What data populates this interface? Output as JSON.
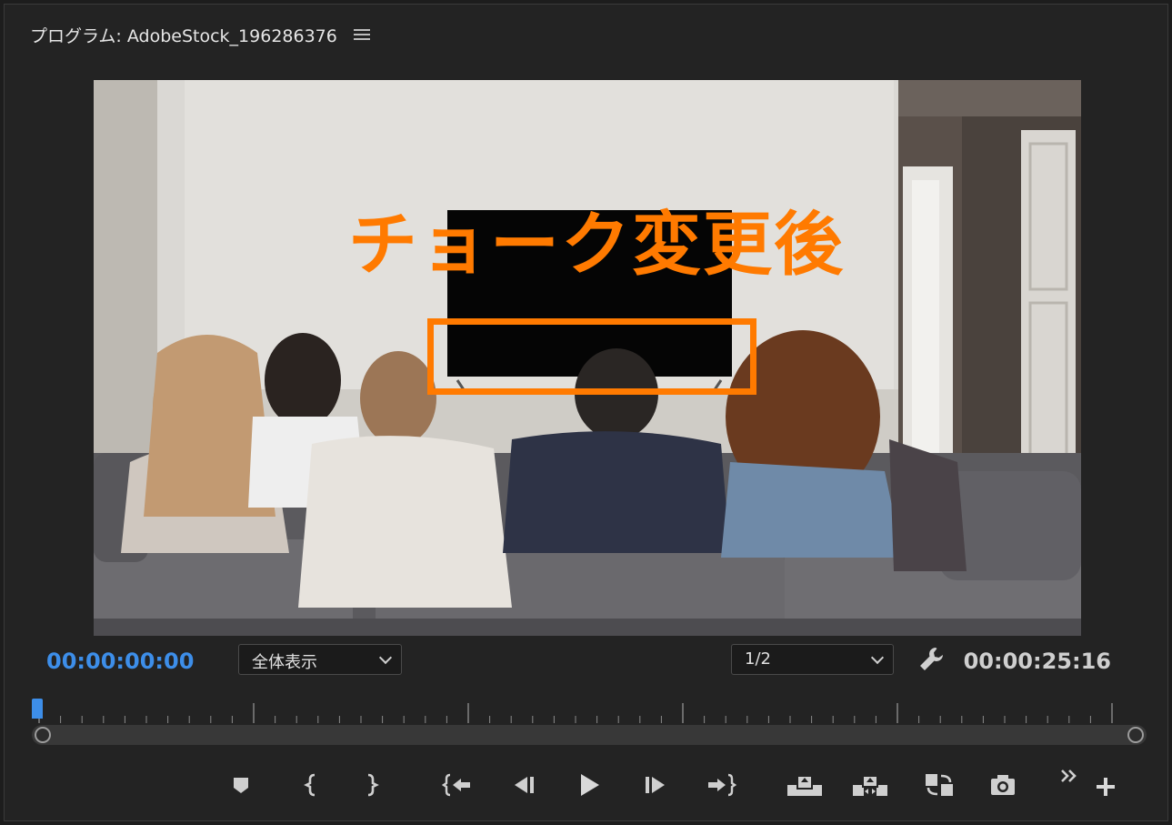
{
  "panel": {
    "title": "プログラム: AdobeStock_196286376"
  },
  "overlay": {
    "text": "チョーク変更後",
    "color": "#ff7a00"
  },
  "timecode": {
    "current": "00:00:00:00",
    "duration": "00:00:25:16",
    "current_color": "#3d8ee9"
  },
  "zoom_select": {
    "value": "全体表示"
  },
  "resolution_select": {
    "value": "1/2"
  },
  "transport": {
    "buttons": [
      "add-marker",
      "mark-in",
      "mark-out",
      "go-to-in",
      "step-back",
      "play",
      "step-forward",
      "go-to-out",
      "lift",
      "extract",
      "insert-overwrite",
      "export-frame",
      "more-controls",
      "button-editor"
    ]
  },
  "playhead": {
    "position_fraction": 0
  },
  "colors": {
    "accent": "#3d8ee9",
    "annotation": "#ff7a00",
    "panel_bg": "#232323"
  }
}
